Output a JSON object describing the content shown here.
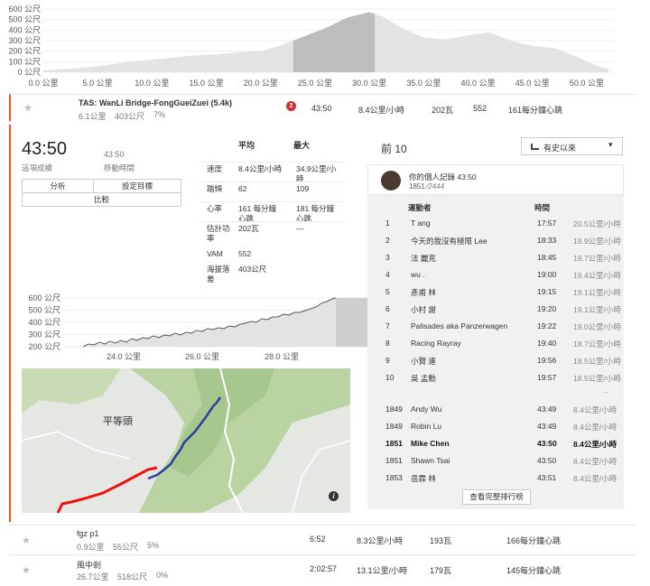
{
  "top_chart": {
    "y_ticks": [
      "600 公尺",
      "500 公尺",
      "400 公尺",
      "300 公尺",
      "200 公尺",
      "100 公尺",
      "0 公尺"
    ],
    "x_ticks": [
      "0.0 公里",
      "5.0 公里",
      "10.0 公里",
      "15.0 公里",
      "20.0 公里",
      "25.0 公里",
      "30.0 公里",
      "35.0 公里",
      "40.0 公里",
      "45.0 公里",
      "50.0 公里"
    ],
    "elevation_profile_km": [
      [
        0,
        20
      ],
      [
        2,
        30
      ],
      [
        4,
        45
      ],
      [
        6,
        70
      ],
      [
        8,
        100
      ],
      [
        10,
        120
      ],
      [
        12,
        140
      ],
      [
        14,
        160
      ],
      [
        16,
        170
      ],
      [
        18,
        190
      ],
      [
        20,
        200
      ],
      [
        22,
        260
      ],
      [
        24,
        340
      ],
      [
        26,
        420
      ],
      [
        28,
        520
      ],
      [
        30,
        570
      ],
      [
        31,
        540
      ],
      [
        33,
        420
      ],
      [
        35,
        330
      ],
      [
        37,
        310
      ],
      [
        39,
        350
      ],
      [
        41,
        380
      ],
      [
        43,
        300
      ],
      [
        45,
        250
      ],
      [
        47,
        230
      ],
      [
        49,
        150
      ],
      [
        51,
        60
      ],
      [
        52,
        30
      ]
    ],
    "highlight_km": [
      23,
      30.5
    ],
    "fill_color": "#e3e3e3",
    "highlight_color": "#bdbdbd"
  },
  "segment": {
    "name": "TAS: WanLi Bridge-FongGueiZuei (5.4k)",
    "distance": "6.1公里",
    "elevation": "403公尺",
    "grade": "7%",
    "badge": "2",
    "time": "43:50",
    "speed": "8.4公里/小時",
    "power": "202瓦",
    "vam": "552",
    "heartrate": "161每分鐘心跳",
    "accent_color": "#f4511e"
  },
  "detail": {
    "elapsed_time": "43:50",
    "elapsed_label": "這項成績",
    "moving_time": "43:50",
    "moving_label": "移動時間",
    "buttons": {
      "analyze": "分析",
      "set_goal": "設定目標",
      "compare": "比較"
    },
    "stats_header": {
      "avg": "平均",
      "max": "最大"
    },
    "stats": [
      {
        "label": "速度",
        "avg": "8.4公里/小時",
        "max": "34.9公里/小時"
      },
      {
        "label": "踏頻",
        "avg": "62",
        "max": "109"
      },
      {
        "label": "心率",
        "avg": "161 每分鐘心跳",
        "max": "181 每分鐘心跳"
      },
      {
        "label": "估計功率",
        "avg": "202瓦",
        "max": "—"
      },
      {
        "label": "VAM",
        "avg": "552",
        "max": ""
      },
      {
        "label": "海拔落差",
        "avg": "403公尺",
        "max": ""
      }
    ],
    "mini_chart": {
      "y_ticks": [
        "600 公尺",
        "500 公尺",
        "400 公尺",
        "300 公尺",
        "200 公尺"
      ],
      "x_ticks": [
        "24.0 公里",
        "26.0 公里",
        "28.0 公里"
      ]
    }
  },
  "map": {
    "place_label": "平等頭",
    "info_icon": "i"
  },
  "leaderboard": {
    "title": "前 10",
    "filter_label": "有史以來",
    "pr_label": "你的個人記錄 43:50",
    "pr_rank": "1851",
    "pr_total": "/2444",
    "col_athlete": "運動者",
    "col_time": "時間",
    "top10": [
      {
        "rank": "1",
        "name": "T ang",
        "time": "17:57",
        "speed": "20.5公里/小時"
      },
      {
        "rank": "2",
        "name": "今天的我沒有極限 Lee",
        "time": "18:33",
        "speed": "19.9公里/小時"
      },
      {
        "rank": "3",
        "name": "法 麗克",
        "time": "18:45",
        "speed": "19.7公里/小時"
      },
      {
        "rank": "4",
        "name": "wu .",
        "time": "19:00",
        "speed": "19.4公里/小時"
      },
      {
        "rank": "5",
        "name": "彥甫 林",
        "time": "19:15",
        "speed": "19.1公里/小時"
      },
      {
        "rank": "6",
        "name": "小村 謝",
        "time": "19:20",
        "speed": "19.1公里/小時"
      },
      {
        "rank": "7",
        "name": "Palisades aka Panzerwagen",
        "time": "19:22",
        "speed": "19.0公里/小時"
      },
      {
        "rank": "8",
        "name": "Racing Rayray",
        "time": "19:40",
        "speed": "18.7公里/小時"
      },
      {
        "rank": "9",
        "name": "小賢 連",
        "time": "19:56",
        "speed": "18.5公里/小時"
      },
      {
        "rank": "10",
        "name": "吳 孟勳",
        "time": "19:57",
        "speed": "18.5公里/小時"
      }
    ],
    "ellipsis": "...",
    "nearby": [
      {
        "rank": "1849",
        "name": "Andy Wu",
        "time": "43:49",
        "speed": "8.4公里/小時"
      },
      {
        "rank": "1849",
        "name": "Robin Lu",
        "time": "43:49",
        "speed": "8.4公里/小時"
      },
      {
        "rank": "1851",
        "name": "Mike Chen",
        "time": "43:50",
        "speed": "8.4公里/小時",
        "current": true
      },
      {
        "rank": "1851",
        "name": "Shawn Tsai",
        "time": "43:50",
        "speed": "8.4公里/小時"
      },
      {
        "rank": "1853",
        "name": "岳霖 林",
        "time": "43:51",
        "speed": "8.4公里/小時"
      }
    ],
    "view_full": "查看完整排行榜"
  },
  "other_segments": [
    {
      "name": "fgz p1",
      "distance": "0.9公里",
      "elevation": "55公尺",
      "grade": "5%",
      "time": "6:52",
      "speed": "8.3公里/小時",
      "power": "193瓦",
      "heartrate": "166每分鐘心跳"
    },
    {
      "name": "風中剎",
      "distance": "26.7公里",
      "elevation": "518公尺",
      "grade": "0%",
      "time": "2:02:57",
      "speed": "13.1公里/小時",
      "power": "179瓦",
      "heartrate": "145每分鐘心跳"
    }
  ]
}
